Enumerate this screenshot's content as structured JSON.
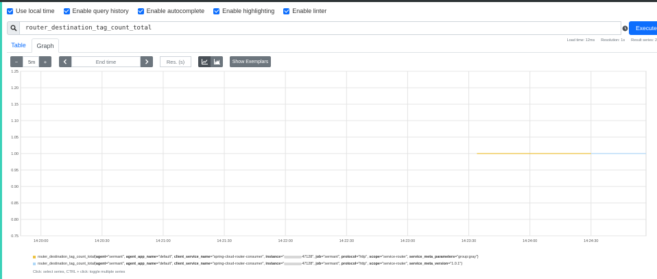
{
  "options": [
    {
      "label": "Use local time",
      "checked": true
    },
    {
      "label": "Enable query history",
      "checked": true
    },
    {
      "label": "Enable autocomplete",
      "checked": true
    },
    {
      "label": "Enable highlighting",
      "checked": true
    },
    {
      "label": "Enable linter",
      "checked": true
    }
  ],
  "query": {
    "search_icon": "search-icon",
    "expression": "router_destination_tag_count_total",
    "history_icon": "history-icon",
    "execute_label": "Execute"
  },
  "stats": {
    "load_time": "Load time: 12ms",
    "resolution": "Resolution: 1s",
    "result_series": "Result series: 2"
  },
  "tabs": {
    "table": "Table",
    "graph": "Graph",
    "active": "graph"
  },
  "controls": {
    "range_minus": "−",
    "range_value": "5m",
    "range_plus": "+",
    "prev": "‹",
    "end_time_placeholder": "End time",
    "next": "›",
    "resolution_placeholder": "Res. (s)",
    "stack_line_icon": "line-chart-icon",
    "stack_area_icon": "area-chart-icon",
    "exemplars": "Show Exemplars"
  },
  "chart_data": {
    "type": "line",
    "x_ticks": [
      "14:20:00",
      "14:20:30",
      "14:21:00",
      "14:21:30",
      "14:22:00",
      "14:22:30",
      "14:23:00",
      "14:23:30",
      "14:24:00",
      "14:24:30"
    ],
    "y_ticks": [
      "1.25",
      "1.20",
      "1.15",
      "1.10",
      "1.05",
      "1.00",
      "0.95",
      "0.90",
      "0.85",
      "0.80",
      "0.75"
    ],
    "ylim": [
      0.75,
      1.25
    ],
    "x_range": [
      "14:19:50",
      "14:24:57"
    ],
    "grid": true,
    "series": [
      {
        "color": "#edc240",
        "x": [
          "14:23:34",
          "14:24:30"
        ],
        "values": [
          1,
          1
        ]
      },
      {
        "color": "#afd8f8",
        "x": [
          "14:24:30",
          "14:24:57"
        ],
        "values": [
          1,
          1
        ]
      }
    ]
  },
  "legend": [
    {
      "color": "#edc240",
      "metric": "router_destination_tag_count_total",
      "labels": [
        {
          "k": "agent",
          "v": "sermant"
        },
        {
          "k": "agent_app_name",
          "v": "default"
        },
        {
          "k": "client_service_name",
          "v": "spring-cloud-router-consumer"
        },
        {
          "k": "instance",
          "v": "47128",
          "redacted": true
        },
        {
          "k": "job",
          "v": "sermant"
        },
        {
          "k": "protocol",
          "v": "http"
        },
        {
          "k": "scope",
          "v": "service-router"
        },
        {
          "k": "service_meta_parameters",
          "v": "group:gray"
        }
      ]
    },
    {
      "color": "#afd8f8",
      "metric": "router_destination_tag_count_total",
      "labels": [
        {
          "k": "agent",
          "v": "sermant"
        },
        {
          "k": "agent_app_name",
          "v": "default"
        },
        {
          "k": "client_service_name",
          "v": "spring-cloud-router-consumer"
        },
        {
          "k": "instance",
          "v": "47128",
          "redacted": true
        },
        {
          "k": "job",
          "v": "sermant"
        },
        {
          "k": "protocol",
          "v": "http"
        },
        {
          "k": "scope",
          "v": "service-router"
        },
        {
          "k": "service_meta_version",
          "v": "1.0.1"
        }
      ]
    }
  ],
  "hint": "Click: select series, CTRL + click: toggle multiple series"
}
